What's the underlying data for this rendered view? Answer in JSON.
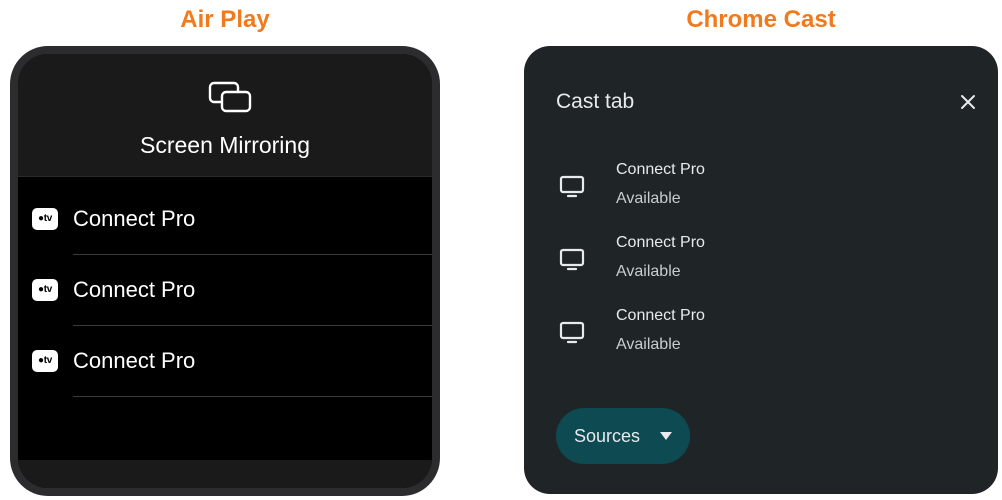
{
  "headings": {
    "airplay": "Air Play",
    "chromecast": "Chrome Cast"
  },
  "airplay": {
    "title": "Screen Mirroring",
    "header_icon": "screen-mirroring-icon",
    "badge_icon": "apple-tv-icon",
    "badge_text": "\u0000tv",
    "devices": [
      {
        "label": "Connect Pro"
      },
      {
        "label": "Connect Pro"
      },
      {
        "label": "Connect Pro"
      }
    ]
  },
  "cast": {
    "title": "Cast tab",
    "close_icon": "close-icon",
    "device_icon": "monitor-icon",
    "devices": [
      {
        "name": "Connect Pro",
        "status": "Available"
      },
      {
        "name": "Connect Pro",
        "status": "Available"
      },
      {
        "name": "Connect Pro",
        "status": "Available"
      }
    ],
    "sources_label": "Sources"
  },
  "colors": {
    "heading_orange": "#f07a1c",
    "airplay_bezel": "#2c2c2e",
    "airplay_background": "#000000",
    "cast_background": "#1f2426",
    "sources_button": "#0d4a52"
  }
}
